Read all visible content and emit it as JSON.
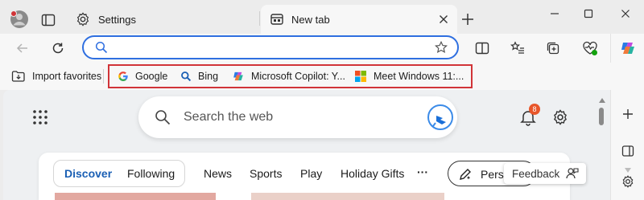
{
  "tabs": [
    {
      "label": "Settings",
      "icon": "gear-icon"
    },
    {
      "label": "New tab",
      "icon": "new-tab-icon",
      "active": true
    }
  ],
  "window_controls": [
    "minimize-icon",
    "maximize-icon",
    "close-icon"
  ],
  "address_bar": {
    "value": "",
    "placeholder": ""
  },
  "favorites": {
    "import_label": "Import favorites",
    "items": [
      {
        "label": "Google",
        "icon": "google-icon"
      },
      {
        "label": "Bing",
        "icon": "bing-search-icon"
      },
      {
        "label": "Microsoft Copilot: Y...",
        "icon": "copilot-icon"
      },
      {
        "label": "Meet Windows 11:...",
        "icon": "windows-icon"
      }
    ],
    "highlight_color": "#d13438"
  },
  "newtab": {
    "search_placeholder": "Search the web",
    "notification_count": "8",
    "feed_tabs": {
      "discover": "Discover",
      "following": "Following",
      "items": [
        "News",
        "Sports",
        "Play",
        "Holiday Gifts"
      ],
      "more": "···"
    },
    "personalize_label": "Perso",
    "feedback_label": "Feedback"
  },
  "colors": {
    "accent": "#2f6fe0",
    "badge": "#e8562a",
    "discover": "#1a5fb4"
  }
}
